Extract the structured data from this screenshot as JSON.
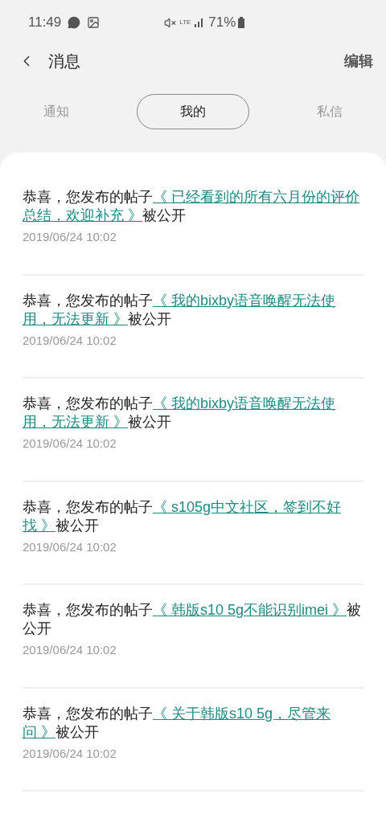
{
  "status_bar": {
    "time": "11:49",
    "network": "LTE",
    "battery": "71%"
  },
  "header": {
    "title": "消息",
    "action": "编辑"
  },
  "tabs": [
    {
      "label": "通知",
      "selected": false
    },
    {
      "label": "我的",
      "selected": true
    },
    {
      "label": "私信",
      "selected": false
    }
  ],
  "messages": [
    {
      "prefix": "恭喜，您发布的帖子",
      "link": "《 已经看到的所有六月份的评价总结，欢迎补充 》",
      "suffix": "被公开",
      "time": "2019/06/24 10:02"
    },
    {
      "prefix": "恭喜，您发布的帖子",
      "link": "《 我的bixby语音唤醒无法使用，无法更新 》",
      "suffix": "被公开",
      "time": "2019/06/24 10:02"
    },
    {
      "prefix": "恭喜，您发布的帖子",
      "link": "《 我的bixby语音唤醒无法使用，无法更新 》",
      "suffix": "被公开",
      "time": "2019/06/24 10:02"
    },
    {
      "prefix": "恭喜，您发布的帖子",
      "link": "《 s105g中文社区，签到不好找 》",
      "suffix": "被公开",
      "time": "2019/06/24 10:02"
    },
    {
      "prefix": "恭喜，您发布的帖子",
      "link": "《 韩版s10 5g不能识别imei 》",
      "suffix": "被公开",
      "time": "2019/06/24 10:02"
    },
    {
      "prefix": "恭喜，您发布的帖子",
      "link": "《 关于韩版s10 5g，尽管来问 》",
      "suffix": "被公开",
      "time": "2019/06/24 10:02"
    }
  ]
}
